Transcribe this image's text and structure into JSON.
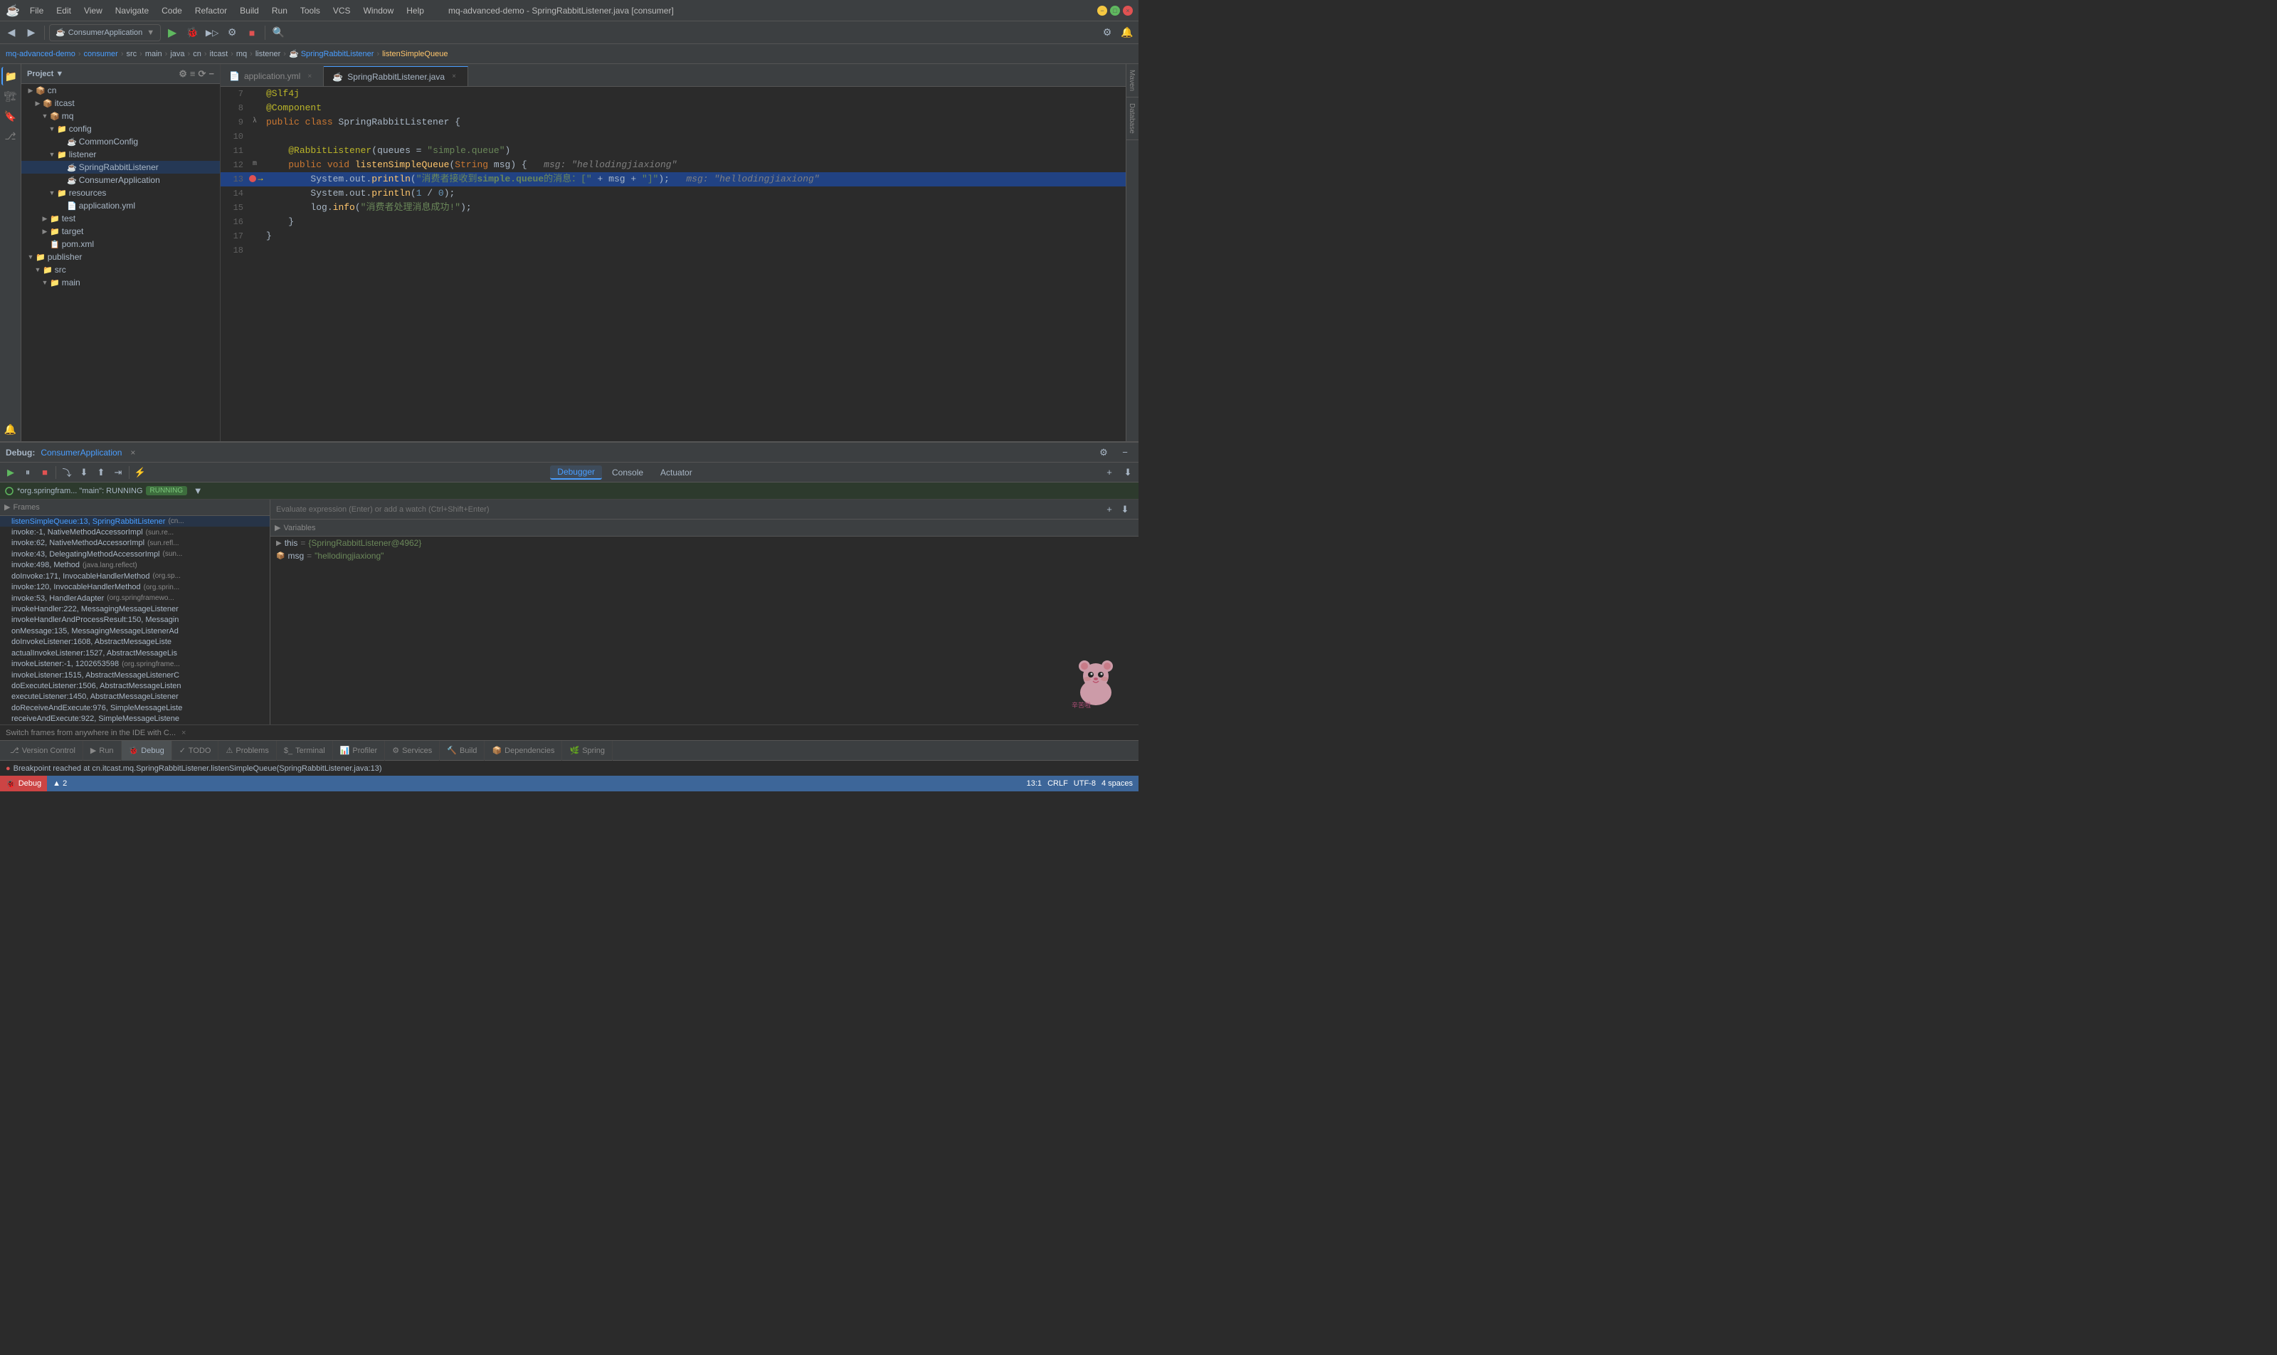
{
  "titlebar": {
    "title": "mq-advanced-demo - SpringRabbitListener.java [consumer]",
    "app_icon": "☕",
    "menus": [
      "File",
      "Edit",
      "View",
      "Navigate",
      "Code",
      "Refactor",
      "Build",
      "Run",
      "Tools",
      "VCS",
      "Window",
      "Help"
    ],
    "win_minimize": "−",
    "win_maximize": "□",
    "win_close": "×"
  },
  "breadcrumb": {
    "parts": [
      "mq-advanced-demo",
      "consumer",
      "src",
      "main",
      "java",
      "cn",
      "itcast",
      "mq",
      "listener",
      "SpringRabbitListener",
      "listenSimpleQueue"
    ]
  },
  "project_panel": {
    "title": "Project",
    "items": [
      {
        "label": "cn",
        "type": "package",
        "depth": 1,
        "expanded": true
      },
      {
        "label": "itcast",
        "type": "package",
        "depth": 2,
        "expanded": true
      },
      {
        "label": "mq",
        "type": "package",
        "depth": 3,
        "expanded": true
      },
      {
        "label": "config",
        "type": "folder",
        "depth": 4,
        "expanded": false
      },
      {
        "label": "CommonConfig",
        "type": "java",
        "depth": 5
      },
      {
        "label": "listener",
        "type": "folder",
        "depth": 4,
        "expanded": true
      },
      {
        "label": "SpringRabbitListener",
        "type": "java",
        "depth": 5,
        "selected": true
      },
      {
        "label": "ConsumerApplication",
        "type": "java",
        "depth": 5
      },
      {
        "label": "resources",
        "type": "folder",
        "depth": 4,
        "expanded": false
      },
      {
        "label": "application.yml",
        "type": "yaml",
        "depth": 5
      },
      {
        "label": "test",
        "type": "folder",
        "depth": 3,
        "expanded": false
      },
      {
        "label": "target",
        "type": "folder",
        "depth": 3,
        "expanded": false
      },
      {
        "label": "pom.xml",
        "type": "xml",
        "depth": 3
      },
      {
        "label": "publisher",
        "type": "folder",
        "depth": 1,
        "expanded": true
      },
      {
        "label": "src",
        "type": "folder",
        "depth": 2,
        "expanded": true
      },
      {
        "label": "main",
        "type": "folder",
        "depth": 3,
        "expanded": false
      }
    ]
  },
  "editor": {
    "tabs": [
      {
        "label": "application.yml",
        "type": "yaml",
        "active": false
      },
      {
        "label": "SpringRabbitListener.java",
        "type": "java",
        "active": true
      }
    ],
    "lines": [
      {
        "num": 7,
        "content": "@Slf4j",
        "type": "annotation"
      },
      {
        "num": 8,
        "content": "@Component",
        "type": "annotation"
      },
      {
        "num": 9,
        "content": "public class SpringRabbitListener {",
        "type": "code"
      },
      {
        "num": 10,
        "content": "",
        "type": "code"
      },
      {
        "num": 11,
        "content": "    @RabbitListener(queues = \"simple.queue\")",
        "type": "annotation"
      },
      {
        "num": 12,
        "content": "    public void listenSimpleQueue(String msg) {",
        "type": "code",
        "hint": "msg: \"hellodingjiaxiong\""
      },
      {
        "num": 13,
        "content": "        System.out.println(\"消费者接收到simple.queue的消息：[\" + msg + \"]\");",
        "type": "highlighted",
        "hint": "msg: \"hellodingjiaxiong\"",
        "breakpoint": true,
        "debug_arrow": true
      },
      {
        "num": 14,
        "content": "        System.out.println(1 / 0);",
        "type": "code"
      },
      {
        "num": 15,
        "content": "        log.info(\"消费者处理消息成功!\");",
        "type": "code"
      },
      {
        "num": 16,
        "content": "    }",
        "type": "code"
      },
      {
        "num": 17,
        "content": "}",
        "type": "code"
      },
      {
        "num": 18,
        "content": "",
        "type": "code"
      }
    ]
  },
  "debug": {
    "title": "Debug:",
    "app_name": "ConsumerApplication",
    "close_label": "×",
    "tabs": [
      "Debugger",
      "Console",
      "Actuator"
    ],
    "active_tab": "Debugger",
    "thread_label": "*org.springfram... \"main\": RUNNING",
    "expression_placeholder": "Evaluate expression (Enter) or add a watch (Ctrl+Shift+Enter)",
    "frames": [
      {
        "name": "listenSimpleQueue:13, SpringRabbitListener",
        "loc": "(cn...",
        "selected": true
      },
      {
        "name": "invoke:-1, NativeMethodAccessorImpl",
        "loc": "(sun.re..."
      },
      {
        "name": "invoke:62, NativeMethodAccessorImpl",
        "loc": "(sun.refl..."
      },
      {
        "name": "invoke:43, DelegatingMethodAccessorImpl",
        "loc": "(sun..."
      },
      {
        "name": "invoke:498, Method",
        "loc": "(java.lang.reflect)"
      },
      {
        "name": "doInvoke:171, InvocableHandlerMethod",
        "loc": "(org.sp..."
      },
      {
        "name": "invoke:120, InvocableHandlerMethod",
        "loc": "(org.sprin..."
      },
      {
        "name": "invoke:53, HandlerAdapter",
        "loc": "(org.springframewo..."
      },
      {
        "name": "invokeHandler:222, MessagingMessageListener",
        "loc": ""
      },
      {
        "name": "invokeHandlerAndProcessResult:150, Messagin",
        "loc": ""
      },
      {
        "name": "onMessage:135, MessagingMessageListenerAd",
        "loc": ""
      },
      {
        "name": "doInvokeListener:1608, AbstractMessageListe",
        "loc": ""
      },
      {
        "name": "actualInvokeListener:1527, AbstractMessageLis",
        "loc": ""
      },
      {
        "name": "invokeListener:-1, 1202653598",
        "loc": "(org.springframe..."
      },
      {
        "name": "invokeListener:1515, AbstractMessageListenerC",
        "loc": ""
      },
      {
        "name": "doExecuteListener:1506, AbstractMessageListen",
        "loc": ""
      },
      {
        "name": "executeListener:1450, AbstractMessageListener",
        "loc": ""
      },
      {
        "name": "doReceiveAndExecute:976, SimpleMessageListe",
        "loc": ""
      },
      {
        "name": "receiveAndExecute:922, SimpleMessageListene",
        "loc": ""
      }
    ],
    "variables": [
      {
        "icon": "▶",
        "key": "this",
        "eq": "=",
        "val": "{SpringRabbitListener@4962}"
      },
      {
        "icon": "📦",
        "key": "msg",
        "eq": "=",
        "val": "\"hellodingjiaxiong\""
      }
    ],
    "switch_frames_hint": "Switch frames from anywhere in the IDE with C..."
  },
  "bottom_tabs": [
    {
      "label": "Version Control",
      "icon": "⎇",
      "active": false
    },
    {
      "label": "Run",
      "icon": "▶",
      "active": false
    },
    {
      "label": "Debug",
      "icon": "🐞",
      "active": true
    },
    {
      "label": "TODO",
      "icon": "✓",
      "active": false
    },
    {
      "label": "Problems",
      "icon": "⚠",
      "active": false
    },
    {
      "label": "Terminal",
      "icon": "$",
      "active": false
    },
    {
      "label": "Profiler",
      "icon": "📊",
      "active": false
    },
    {
      "label": "Services",
      "icon": "⚙",
      "active": false
    },
    {
      "label": "Build",
      "icon": "🔨",
      "active": false
    },
    {
      "label": "Dependencies",
      "icon": "📦",
      "active": false
    },
    {
      "label": "Spring",
      "icon": "🌿",
      "active": false
    }
  ],
  "status_bar": {
    "debug_label": "Debug",
    "breakpoint_text": "Breakpoint reached at cn.itcast.mq.SpringRabbitListener.listenSimpleQueue(SpringRabbitListener.java:13)",
    "position": "13:1",
    "encoding": "CRLF",
    "charset": "UTF-8",
    "indent": "4 spaces",
    "warnings": "▲ 2"
  }
}
